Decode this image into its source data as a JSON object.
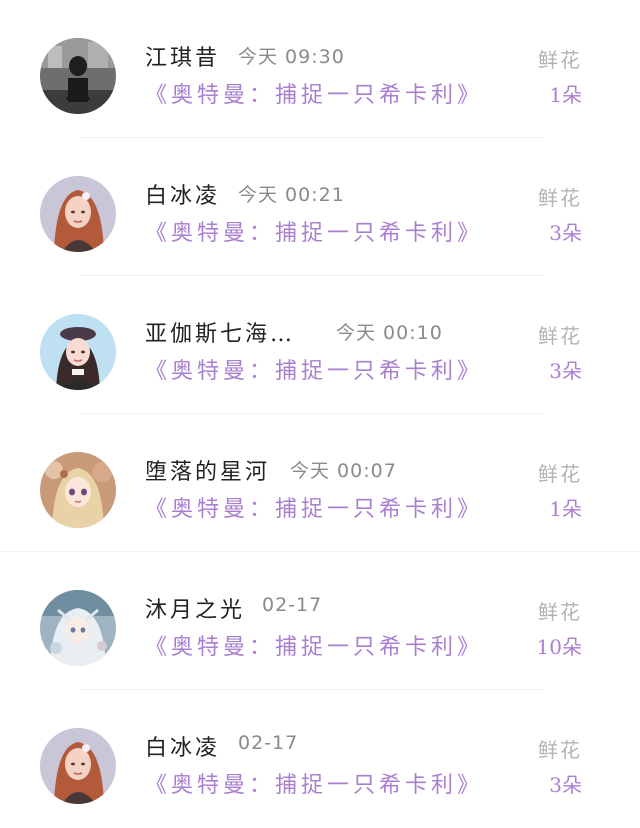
{
  "gift_list": {
    "items": [
      {
        "name": "江琪昔",
        "time": "今天 09:30",
        "title": "《奥特曼：捕捉一只希卡利》",
        "gift_label": "鲜花",
        "count": "1朵",
        "avatar": "monochrome-photo-avatar"
      },
      {
        "name": "白冰凌",
        "time": "今天 00:21",
        "title": "《奥特曼：捕捉一只希卡利》",
        "gift_label": "鲜花",
        "count": "3朵",
        "avatar": "girl-portrait-avatar"
      },
      {
        "name": "亚伽斯七海…",
        "time": "今天 00:10",
        "title": "《奥特曼：捕捉一只希卡利》",
        "gift_label": "鲜花",
        "count": "3朵",
        "avatar": "girl-with-beret-avatar"
      },
      {
        "name": "堕落的星河",
        "time": "今天 00:07",
        "title": "《奥特曼：捕捉一只希卡利》",
        "gift_label": "鲜花",
        "count": "1朵",
        "avatar": "anime-girl-avatar"
      },
      {
        "name": "沐月之光",
        "time": "02-17",
        "title": "《奥特曼：捕捉一只希卡利》",
        "gift_label": "鲜花",
        "count": "10朵",
        "avatar": "anime-illustration-avatar"
      },
      {
        "name": "白冰凌",
        "time": "02-17",
        "title": "《奥特曼：捕捉一只希卡利》",
        "gift_label": "鲜花",
        "count": "3朵",
        "avatar": "girl-portrait-avatar"
      }
    ]
  },
  "colors": {
    "accent": "#a97fd0",
    "name_text": "#222222",
    "muted_text": "#8a8a8a",
    "gift_label": "#b3b3b3"
  }
}
